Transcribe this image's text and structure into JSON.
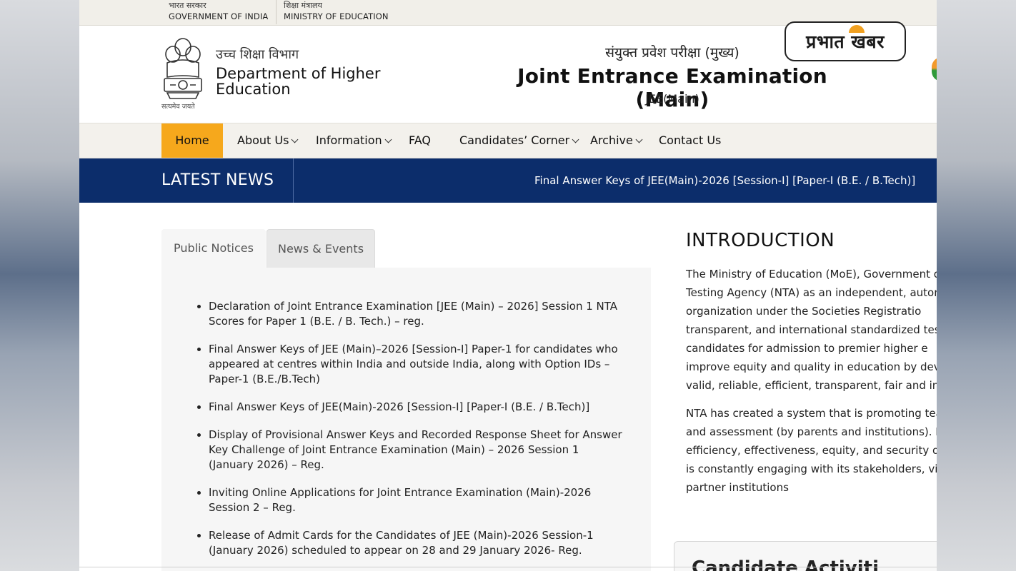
{
  "gov_strip": {
    "left_hi": "भारत सरकार",
    "left_en": "GOVERNMENT OF INDIA",
    "right_hi": "शिक्षा मंत्रालय",
    "right_en": "MINISTRY OF EDUCATION"
  },
  "header": {
    "emblem_caption": "सत्यमेव जयते",
    "dept_hi": "उच्च शिक्षा विभाग",
    "dept_en": "Department of Higher Education",
    "exam_hi": "संयुक्त प्रवेश परीक्षा (मुख्य)",
    "exam_en": "Joint Entrance Examination (Main)",
    "exam_short": "JEE(Main)",
    "logo_text": "प्रभात खबर"
  },
  "nav": {
    "items": [
      {
        "label": "Home",
        "active": true
      },
      {
        "label": "About Us",
        "dropdown": true
      },
      {
        "label": "Information",
        "dropdown": true
      },
      {
        "label": "FAQ"
      },
      {
        "label": "Candidates’ Corner",
        "dropdown": true
      },
      {
        "label": "Archive",
        "dropdown": true
      },
      {
        "label": "Contact Us"
      }
    ]
  },
  "news": {
    "title": "LATEST NEWS",
    "ticker": "Final Answer Keys of JEE(Main)-2026 [Session-I] [Paper-I (B.E. / B.Tech)]"
  },
  "tabs": {
    "public_notices": "Public Notices",
    "news_events": "News & Events"
  },
  "notices": [
    "Declaration of Joint Entrance Examination [JEE (Main) – 2026] Session 1 NTA Scores for Paper 1 (B.E. / B. Tech.) – reg.",
    "Final Answer Keys of JEE (Main)–2026 [Session-I] Paper-1 for candidates who appeared at centres within India and outside India, along with Option IDs – Paper-1 (B.E./B.Tech)",
    "Final Answer Keys of JEE(Main)-2026 [Session-I] [Paper-I (B.E. / B.Tech)]",
    "Display of Provisional Answer Keys and Recorded Response Sheet for Answer Key Challenge of Joint Entrance Examination (Main) – 2026 Session 1 (January 2026) – Reg.",
    "Inviting Online Applications for Joint Entrance Examination (Main)-2026 Session 2 – Reg.",
    "Release of Admit Cards for the Candidates of JEE (Main)-2026 Session-1 (January 2026) scheduled to appear on 28 and 29 January 2026- Reg."
  ],
  "intro": {
    "title": "INTRODUCTION",
    "p1": "The Ministry of Education (MoE), Government of\nTesting Agency (NTA) as an independent, autono\norganization under the Societies Registratio\ntransparent, and international standardized test\ncandidates for admission to premier higher e\nimprove equity and quality in education by deve\nvalid, reliable, efficient, transparent, fair and inter",
    "p2": "NTA has created a system that is promoting teach\nand assessment (by parents and institutions). NTA\nefficiency, effectiveness, equity, and security of as\nis constantly engaging with its stakeholders, viz. s\npartner institutions",
    "activity_title": "Candidate Activiti"
  }
}
